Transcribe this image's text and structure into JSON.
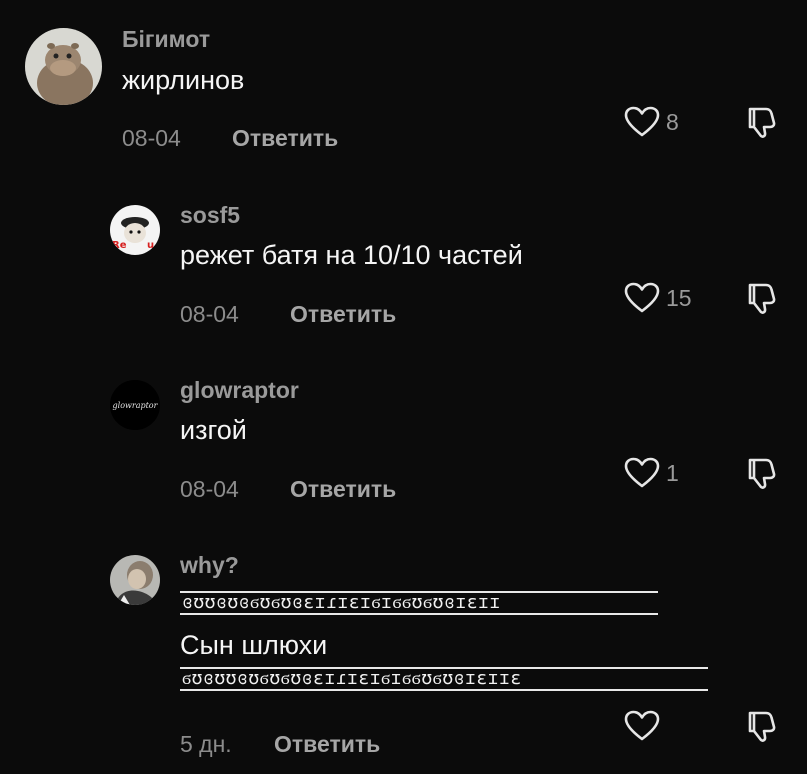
{
  "comments": [
    {
      "username": "Бігимот",
      "text": "жирлинов",
      "date": "08-04",
      "reply_label": "Ответить",
      "likes": "8",
      "avatar_icon": "hippo-avatar"
    },
    {
      "username": "sosf5",
      "text": "режет батя на 10/10 частей",
      "date": "08-04",
      "reply_label": "Ответить",
      "likes": "15",
      "avatar_icon": "dog-avatar"
    },
    {
      "username": "glowraptor",
      "text": "изгой",
      "date": "08-04",
      "reply_label": "Ответить",
      "likes": "1",
      "avatar_icon": "glowraptor-text-avatar",
      "avatar_text": "glowraptor"
    },
    {
      "username": "why?",
      "deco_top": "ɞʊʊɞʊɞϭʊϭʊɞɛɪɾɪɛɪϭɪϭϭʊϭʊɞɪɛɪɪ",
      "text": "Сын шлюхи",
      "deco_bottom": "ϭʊɞʊʊɞʊϭʊϭʊɞɛɪɾɪɛɪϭɪϭϭʊϭʊɞɪɛɪɪɛ",
      "date": "5 дн.",
      "reply_label": "Ответить",
      "likes": "",
      "avatar_icon": "person-avatar"
    }
  ],
  "colors": {
    "background": "#0b0b0b",
    "username": "#9a9a9a",
    "text": "#f5f5f5",
    "meta": "#8c8c8c",
    "icon": "#e6e6e6"
  },
  "icons": {
    "like": "heart-outline-icon",
    "dislike": "thumbs-down-outline-icon"
  }
}
